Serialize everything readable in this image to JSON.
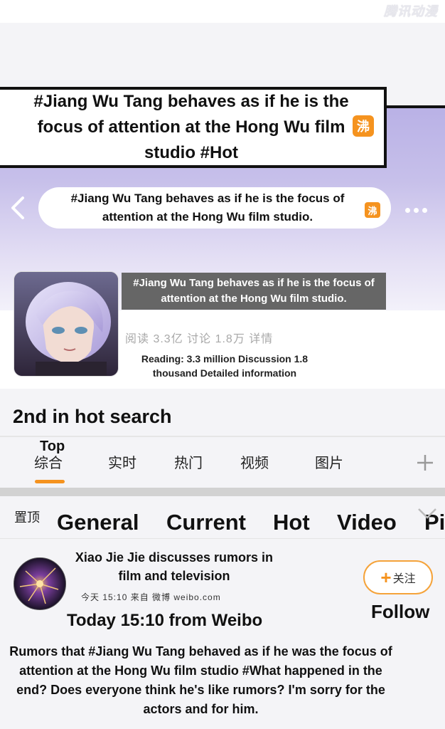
{
  "watermark": "腾讯动漫",
  "top_caption": {
    "text": "#Jiang Wu Tang behaves as if he is the focus of attention at the Hong Wu film studio  #Hot",
    "badge": "沸"
  },
  "search_bar": {
    "text": "#Jiang Wu Tang behaves as if he is the focus of attention at the Hong Wu film studio.",
    "badge": "沸"
  },
  "topic": {
    "overlay_text": "#Jiang Wu Tang behaves as if he is the focus of attention at the Hong Wu film studio.",
    "stats_cn": "阅读 3.3亿 讨论 1.8万 详情",
    "stats_en": "Reading: 3.3 million  Discussion 1.8 thousand   Detailed information"
  },
  "hot_rank": "2nd in hot search",
  "tabs": {
    "top_en": "Top",
    "items_cn": [
      "综合",
      "实时",
      "热门",
      "视频",
      "图片"
    ],
    "items_en": [
      "General",
      "Current",
      "Hot",
      "Video",
      "Pi"
    ],
    "pinned_cn": "置顶"
  },
  "post": {
    "username": "Xiao Jie Jie discusses rumors in film and television",
    "meta_cn": "今天  15:10  来自 微博 weibo.com",
    "time_en": "Today 15:10 from Weibo",
    "follow_cn": "关注",
    "follow_en": "Follow",
    "body": "Rumors that #Jiang Wu Tang behaved as if he was the focus of attention at the Hong Wu film studio #What happened in the end? Does everyone think he's like rumors? I'm sorry for the actors and for him."
  },
  "colors": {
    "accent": "#f5931f",
    "gradient_top": "#b9b1e6",
    "overlay_grey": "#666666"
  }
}
